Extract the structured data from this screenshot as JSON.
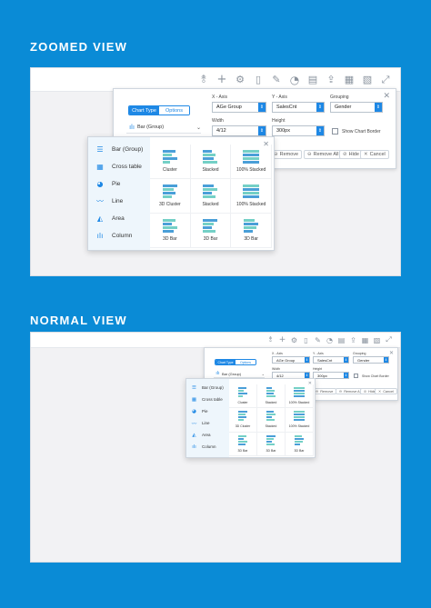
{
  "headings": {
    "zoomed": "ZOOMED VIEW",
    "normal": "NORMAL VIEW"
  },
  "toolbar_icons": [
    "sort-icon",
    "add-icon",
    "filter-settings-icon",
    "document-icon",
    "edit-icon",
    "chart-icon",
    "save-icon",
    "export-icon",
    "table-icon",
    "excel-icon",
    "expand-icon"
  ],
  "tabs": {
    "chart_type": "Chart Type",
    "options": "Options"
  },
  "chart_type_value": "Bar (Group)",
  "fields": {
    "x_axis": {
      "label": "X - Axis",
      "value": "AGe Group"
    },
    "y_axis": {
      "label": "Y - Axis",
      "value": "SalesCnt"
    },
    "grouping": {
      "label": "Grouping",
      "value": "Gender"
    },
    "width": {
      "label": "Width",
      "value": "4/12"
    },
    "height": {
      "label": "Height",
      "value": "300px"
    }
  },
  "show_border_label": "Show Chart Border",
  "actions": {
    "remove": "Remove",
    "remove_all": "Remove All",
    "hide": "Hide",
    "cancel": "Cancel"
  },
  "chart_types": [
    "Bar (Group)",
    "Cross table",
    "Pie",
    "Line",
    "Area",
    "Column"
  ],
  "chart_type_icons": [
    "bar-icon",
    "cross-table-icon",
    "pie-icon",
    "line-icon",
    "area-icon",
    "column-icon"
  ],
  "variants": [
    "Cluster",
    "Stacked",
    "100% Stacked",
    "3D Cluster",
    "Stacked",
    "100% Stacked",
    "3D Bar",
    "3D Bar",
    "3D Bar"
  ],
  "colors": {
    "background": "#0a8bd6",
    "accent": "#1e88e5",
    "bar_blue": "#4a9fd8",
    "bar_teal": "#74d0c6"
  }
}
